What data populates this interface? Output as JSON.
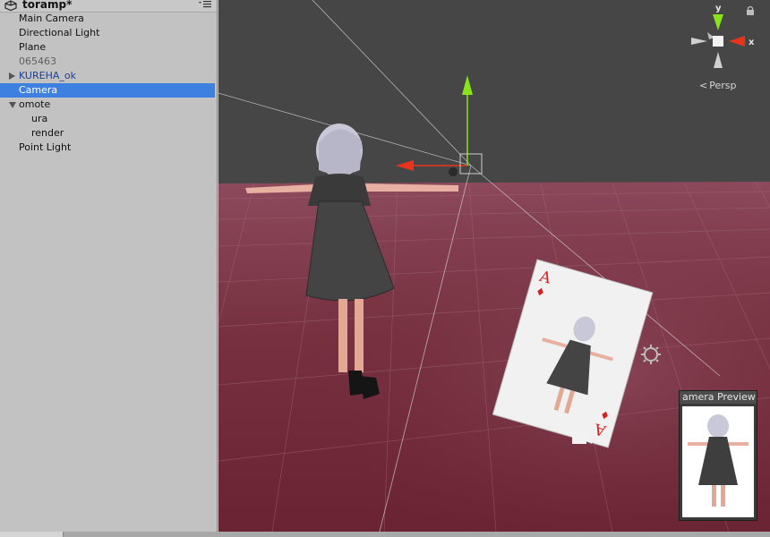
{
  "hierarchy": {
    "scene_name": "toramp*",
    "items": [
      {
        "label": "Main Camera",
        "depth": 0,
        "state": "normal",
        "arrow": "none"
      },
      {
        "label": "Directional Light",
        "depth": 0,
        "state": "normal",
        "arrow": "none"
      },
      {
        "label": "Plane",
        "depth": 0,
        "state": "normal",
        "arrow": "none"
      },
      {
        "label": "065463",
        "depth": 0,
        "state": "inactive",
        "arrow": "none"
      },
      {
        "label": "KUREHA_ok",
        "depth": 0,
        "state": "prefab",
        "arrow": "right"
      },
      {
        "label": "Camera",
        "depth": 0,
        "state": "selected",
        "arrow": "none"
      },
      {
        "label": "omote",
        "depth": 0,
        "state": "normal",
        "arrow": "down"
      },
      {
        "label": "ura",
        "depth": 1,
        "state": "normal",
        "arrow": "none"
      },
      {
        "label": "render",
        "depth": 1,
        "state": "normal",
        "arrow": "none"
      },
      {
        "label": "Point Light",
        "depth": 0,
        "state": "normal",
        "arrow": "none"
      }
    ]
  },
  "scene": {
    "projection_label": "Persp",
    "gizmo_axes": {
      "y": "y",
      "x": "x"
    },
    "card": {
      "rank": "A",
      "suit": "♦"
    },
    "camera_preview_title": "amera Preview",
    "colors": {
      "sky": "#464646",
      "floor": "#7a3447",
      "x_axis": "#e8341c",
      "y_axis": "#8ae218",
      "selection": "#3d80df"
    },
    "icons": [
      "unity-scene-icon",
      "hierarchy-menu-icon",
      "lock-icon",
      "orientation-gizmo-icon",
      "camera-gizmo-icon",
      "light-gizmo-icon"
    ]
  }
}
